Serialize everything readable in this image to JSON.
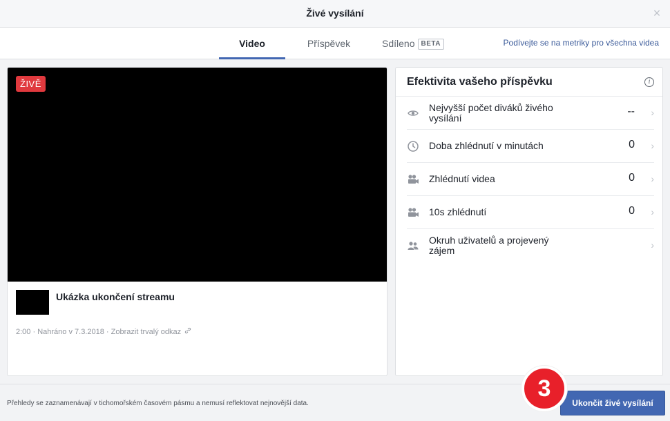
{
  "dialog": {
    "title": "Živé vysílání",
    "close_glyph": "×"
  },
  "tabs": [
    {
      "label": "Video",
      "active": true
    },
    {
      "label": "Příspěvek",
      "active": false
    },
    {
      "label": "Sdíleno",
      "badge": "BETA",
      "active": false
    }
  ],
  "metrics_link": "Podívejte se na metriky pro všechna videa",
  "video": {
    "live_badge": "ŽIVĚ",
    "title": "Ukázka ukončení streamu",
    "duration": "2:00",
    "uploaded": "Nahráno v 7.3.2018",
    "permalink": "Zobrazit trvalý odkaz"
  },
  "performance": {
    "title": "Efektivita vašeho příspěvku",
    "info_icon": "info-icon",
    "metrics": [
      {
        "label": "Nejvyšší počet diváků živého vysílání",
        "value": "--",
        "icon": "eye-icon"
      },
      {
        "label": "Doba zhlédnutí v minutách",
        "value": "0",
        "icon": "clock-icon"
      },
      {
        "label": "Zhlédnutí videa",
        "value": "0",
        "icon": "video-camera-icon"
      },
      {
        "label": "10s zhlédnutí",
        "value": "0",
        "icon": "video-camera-icon"
      },
      {
        "label": "Okruh uživatelů a projevený zájem",
        "value": "",
        "icon": "people-icon"
      }
    ]
  },
  "footer": {
    "note": "Přehledy se zaznamenávají v tichomořském časovém pásmu a nemusí reflektovat nejnovější data.",
    "end_button": "Ukončit živé vysílání"
  },
  "step_marker": "3",
  "colors": {
    "accent": "#4267b2",
    "live": "#e0393e",
    "marker": "#e8202a"
  }
}
